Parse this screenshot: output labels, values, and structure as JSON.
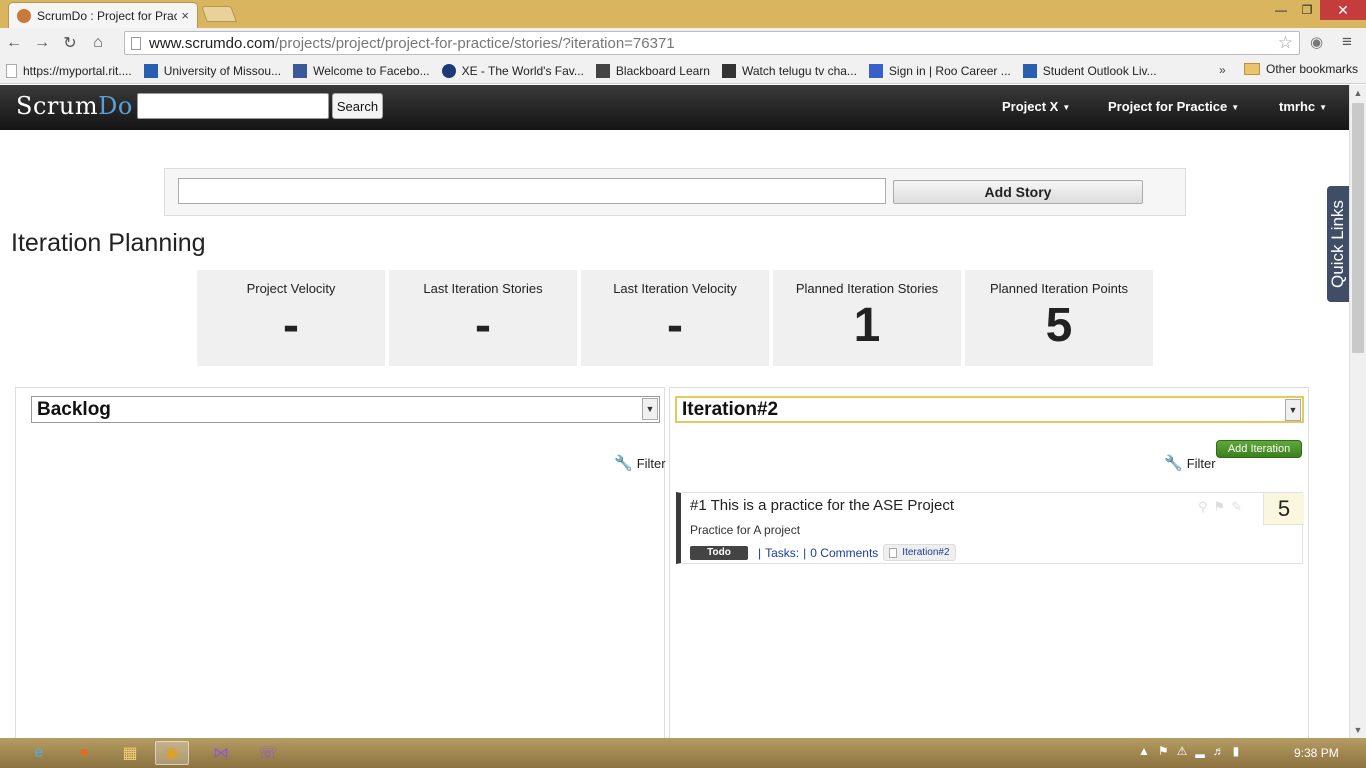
{
  "browser": {
    "tab_title": "ScrumDo : Project for Prac",
    "tab_close": "×",
    "url_host": "www.scrumdo.com",
    "url_path": "/projects/project/project-for-practice/stories/?iteration=76371",
    "bookmarks": [
      "https://myportal.rit....",
      "University of Missou...",
      "Welcome to Facebo...",
      "XE - The World's Fav...",
      "Blackboard Learn",
      "Watch telugu tv cha...",
      "Sign in | Roo Career ...",
      "Student Outlook Liv..."
    ],
    "bookmarks_more": "»",
    "other_bookmarks": "Other bookmarks"
  },
  "header": {
    "logo_scrum": "Scrum",
    "logo_do": "Do",
    "search_button": "Search",
    "menu": [
      "Project X",
      "Project for Practice",
      "tmrhc"
    ]
  },
  "quick_links": "Quick Links",
  "add_story": {
    "button": "Add Story"
  },
  "page_title": "Iteration Planning",
  "stats": [
    {
      "label": "Project Velocity",
      "value": "-"
    },
    {
      "label": "Last Iteration Stories",
      "value": "-"
    },
    {
      "label": "Last Iteration Velocity",
      "value": "-"
    },
    {
      "label": "Planned Iteration Stories",
      "value": "1"
    },
    {
      "label": "Planned Iteration Points",
      "value": "5"
    }
  ],
  "left_panel": {
    "select_value": "Backlog",
    "filter_label": "Filter"
  },
  "right_panel": {
    "select_value": "Iteration#2",
    "filter_label": "Filter",
    "add_iteration": "Add Iteration",
    "story": {
      "title": "#1 This is a practice for the ASE Project",
      "description": "Practice for A project",
      "status": "Todo",
      "tasks": "Tasks:",
      "comments": "0 Comments",
      "iteration_tag": "Iteration#2",
      "points": "5"
    }
  },
  "taskbar": {
    "clock": "9:38 PM"
  },
  "colors": {
    "header_bg": "#1e1e1e",
    "logo_accent": "#5aa0d6",
    "add_iteration": "#4a9428",
    "quick_links": "#3f4d66"
  }
}
